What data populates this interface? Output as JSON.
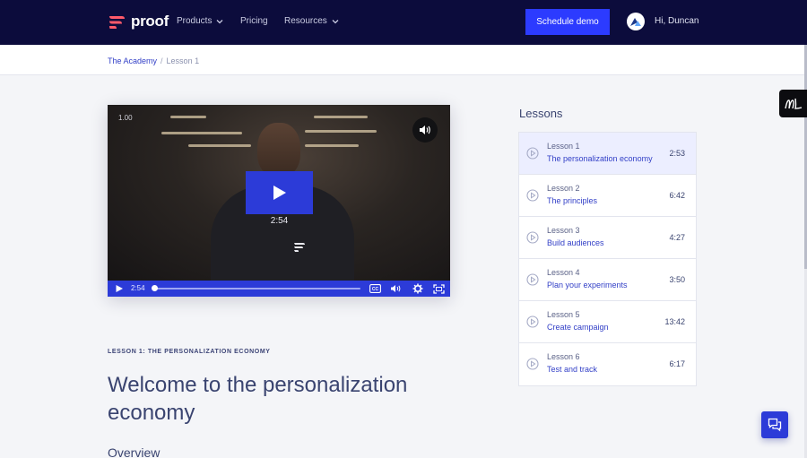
{
  "nav": {
    "brand": "proof",
    "items": [
      {
        "label": "Products",
        "has_dropdown": true
      },
      {
        "label": "Pricing",
        "has_dropdown": false
      },
      {
        "label": "Resources",
        "has_dropdown": true
      }
    ],
    "cta_label": "Schedule demo",
    "greeting": "Hi, Duncan"
  },
  "breadcrumb": {
    "parent": "The Academy",
    "separator": "/",
    "current": "Lesson 1"
  },
  "video": {
    "speed": "1.00",
    "big_time": "2:54",
    "control_time": "2:54",
    "progress": 0
  },
  "lesson_header": {
    "tag": "LESSON 1: THE PERSONALIZATION ECONOMY",
    "title": "Welcome to the personalization economy",
    "overview": "Overview"
  },
  "lessons": {
    "heading": "Lessons",
    "items": [
      {
        "number": "Lesson 1",
        "name": "The personalization economy",
        "duration": "2:53",
        "active": true
      },
      {
        "number": "Lesson 2",
        "name": "The principles",
        "duration": "6:42",
        "active": false
      },
      {
        "number": "Lesson 3",
        "name": "Build audiences",
        "duration": "4:27",
        "active": false
      },
      {
        "number": "Lesson 4",
        "name": "Plan your experiments",
        "duration": "3:50",
        "active": false
      },
      {
        "number": "Lesson 5",
        "name": "Create campaign",
        "duration": "13:42",
        "active": false
      },
      {
        "number": "Lesson 6",
        "name": "Test and track",
        "duration": "6:17",
        "active": false
      }
    ]
  },
  "colors": {
    "nav_bg": "#0c0c3c",
    "accent": "#2c3bff",
    "video_accent": "#2c3bd8",
    "brand_logo": "#ff5a6a",
    "link": "#3340c7"
  },
  "icons": {
    "brand": "proof-logo-icon",
    "chevron": "chevron-down-icon",
    "avatar": "avatar-logo-icon",
    "volume": "volume-icon",
    "play": "play-icon",
    "captions": "closed-captions-icon",
    "settings": "gear-icon",
    "fullscreen": "fullscreen-icon",
    "lesson_play": "play-circle-icon",
    "ml_badge": "ml-badge-icon",
    "chat": "chat-icon"
  }
}
